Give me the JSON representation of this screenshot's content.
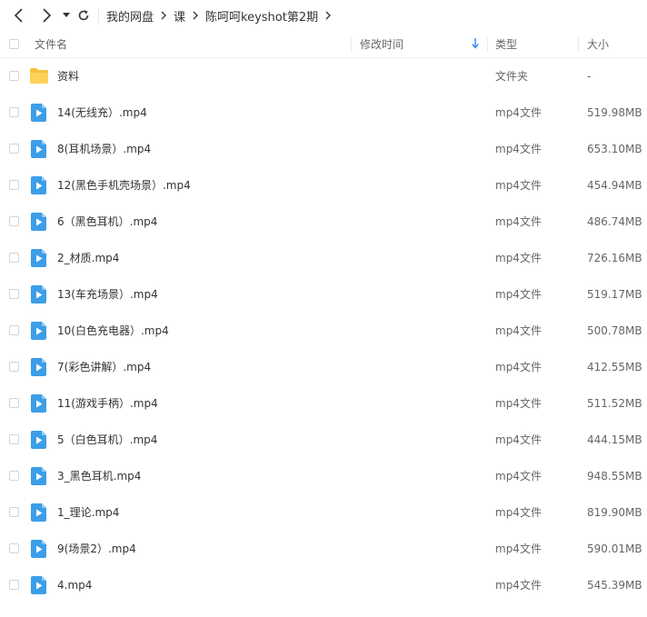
{
  "breadcrumb": [
    "我的网盘",
    "课",
    "陈呵呵keyshot第2期"
  ],
  "columns": {
    "name": "文件名",
    "modified": "修改时间",
    "type": "类型",
    "size": "大小"
  },
  "files": [
    {
      "name": "资料",
      "type": "文件夹",
      "size": "-",
      "icon": "folder-icon"
    },
    {
      "name": "14(无线充）.mp4",
      "type": "mp4文件",
      "size": "519.98MB",
      "icon": "video-file-icon"
    },
    {
      "name": "8(耳机场景）.mp4",
      "type": "mp4文件",
      "size": "653.10MB",
      "icon": "video-file-icon"
    },
    {
      "name": "12(黑色手机壳场景）.mp4",
      "type": "mp4文件",
      "size": "454.94MB",
      "icon": "video-file-icon"
    },
    {
      "name": "6（黑色耳机）.mp4",
      "type": "mp4文件",
      "size": "486.74MB",
      "icon": "video-file-icon"
    },
    {
      "name": "2_材质.mp4",
      "type": "mp4文件",
      "size": "726.16MB",
      "icon": "video-file-icon"
    },
    {
      "name": "13(车充场景）.mp4",
      "type": "mp4文件",
      "size": "519.17MB",
      "icon": "video-file-icon"
    },
    {
      "name": "10(白色充电器）.mp4",
      "type": "mp4文件",
      "size": "500.78MB",
      "icon": "video-file-icon"
    },
    {
      "name": "7(彩色讲解）.mp4",
      "type": "mp4文件",
      "size": "412.55MB",
      "icon": "video-file-icon"
    },
    {
      "name": "11(游戏手柄）.mp4",
      "type": "mp4文件",
      "size": "511.52MB",
      "icon": "video-file-icon"
    },
    {
      "name": "5（白色耳机）.mp4",
      "type": "mp4文件",
      "size": "444.15MB",
      "icon": "video-file-icon"
    },
    {
      "name": "3_黑色耳机.mp4",
      "type": "mp4文件",
      "size": "948.55MB",
      "icon": "video-file-icon"
    },
    {
      "name": "1_理论.mp4",
      "type": "mp4文件",
      "size": "819.90MB",
      "icon": "video-file-icon"
    },
    {
      "name": "9(场景2）.mp4",
      "type": "mp4文件",
      "size": "590.01MB",
      "icon": "video-file-icon"
    },
    {
      "name": "4.mp4",
      "type": "mp4文件",
      "size": "545.39MB",
      "icon": "video-file-icon"
    }
  ],
  "colors": {
    "folder": "#f7c33c",
    "video": "#3d9ee8",
    "sort_arrow": "#2b8df0"
  }
}
